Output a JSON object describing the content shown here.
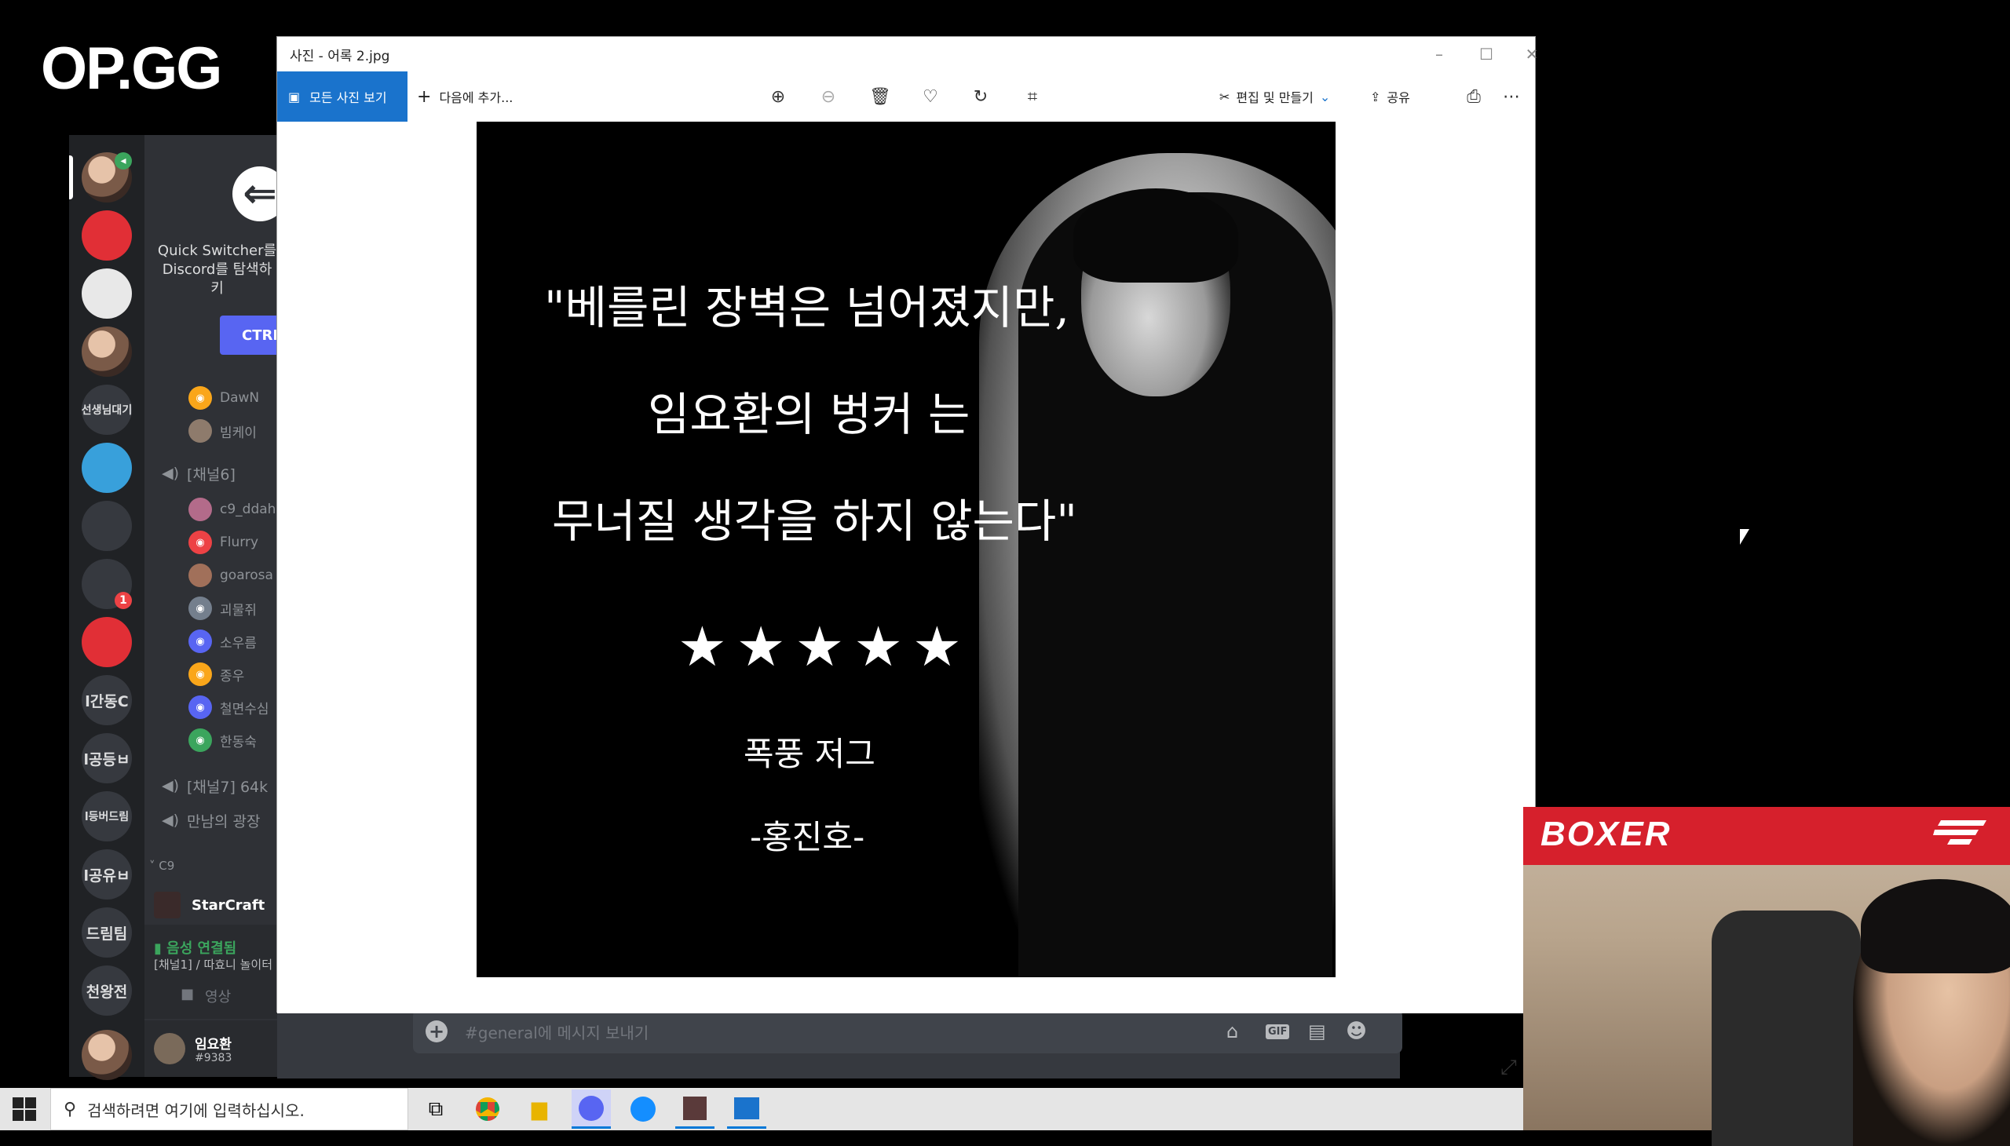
{
  "stream": {
    "logo": "OP.GG"
  },
  "discord": {
    "guilds": [
      {
        "name": "",
        "badge": ""
      },
      {
        "name": "",
        "badge": ""
      },
      {
        "name": "",
        "badge": ""
      },
      {
        "name": "",
        "badge": ""
      },
      {
        "name": "선생님대기",
        "badge": ""
      },
      {
        "name": "",
        "badge": ""
      },
      {
        "name": "",
        "badge": ""
      },
      {
        "name": "",
        "badge": "1"
      },
      {
        "name": "",
        "badge": ""
      },
      {
        "name": "l간동C",
        "badge": ""
      },
      {
        "name": "l공등ㅂ",
        "badge": ""
      },
      {
        "name": "l등버드림",
        "badge": ""
      },
      {
        "name": "l공유ㅂ",
        "badge": ""
      },
      {
        "name": "드림팀",
        "badge": ""
      },
      {
        "name": "천왕전",
        "badge": ""
      },
      {
        "name": "",
        "badge": ""
      }
    ],
    "quick_switcher": {
      "text_line1": "Quick Switcher를",
      "text_line2": "Discord를 탐색하",
      "text_line3": "키",
      "button_label": "CTRL"
    },
    "members_top": [
      "DawN",
      "빔케이"
    ],
    "channel6": "[채널6]",
    "members_ch6": [
      "c9_ddah",
      "Flurry",
      "goarosa",
      "괴물쥐",
      "소우름",
      "종우",
      "철면수심",
      "한동숙"
    ],
    "channel7": "[채널7] 64k",
    "channel_plaza": "만남의 광장",
    "category": "C9",
    "game_activity": "StarCraft",
    "voice_connected": "음성 연결됨",
    "voice_channel": "[채널1] / 따효니 놀이터",
    "video_label": "영상",
    "user": {
      "name": "임요환",
      "tag": "#9383"
    },
    "chat_placeholder": "#general에 메시지 보내기"
  },
  "photos": {
    "window_title": "사진 - 어록 2.jpg",
    "all_photos_label": "모든 사진 보기",
    "add_to_label": "다음에 추가...",
    "edit_create_label": "편집 및 만들기",
    "share_label": "공유",
    "image": {
      "quote_line1": "\"베를린 장벽은 넘어졌지만,",
      "quote_line2": "임요환의 벙커 는",
      "quote_line3": "무너질 생각을 하지 않는다\"",
      "stars": "★★★★★",
      "subtitle": "폭풍 저그",
      "author": "-홍진호-"
    }
  },
  "webcam": {
    "name": "BOXER",
    "team_logo": "T1"
  },
  "taskbar": {
    "search_placeholder": "검색하려면 여기에 입력하십시오."
  }
}
